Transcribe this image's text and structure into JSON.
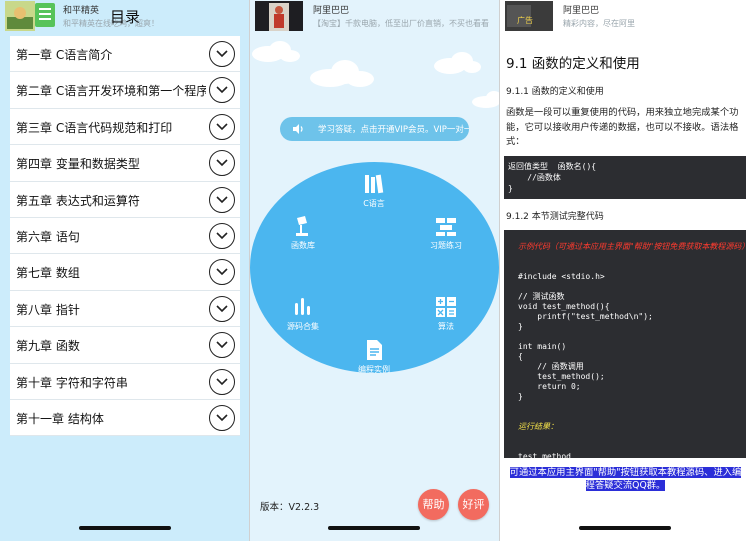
{
  "screen1": {
    "ad_title": "和平精英",
    "ad_subtitle": "和平精英在线吃鸡，超爽！",
    "title": "目录",
    "chapters": [
      "第一章 C语言简介",
      "第二章 C语言开发环境和第一个程序",
      "第三章 C语言代码规范和打印",
      "第四章 变量和数据类型",
      "第五章 表达式和运算符",
      "第六章 语句",
      "第七章 数组",
      "第八章 指针",
      "第九章 函数",
      "第十章 字符和字符串",
      "第十一章 结构体"
    ]
  },
  "screen2": {
    "ad_title": "阿里巴巴",
    "ad_subtitle": "【淘宝】千款电脑，低至出厂价直销，不买也看看",
    "notice": "学习答疑，点击开通VIP会员。VIP一对一答疑",
    "menu": {
      "c_lang": "C语言",
      "func_lib": "函数库",
      "exercises": "习题练习",
      "source_code": "源码合集",
      "algorithm": "算法",
      "examples": "编程实例"
    },
    "version": "版本：V2.2.3",
    "help_btn": "帮助",
    "rate_btn": "好评",
    "colors": {
      "circle": "#4bb6ef",
      "button": "#f26b5f"
    }
  },
  "screen3": {
    "ad_title": "阿里巴巴",
    "ad_subtitle": "精彩内容，尽在阿里",
    "heading": "9.1 函数的定义和使用",
    "sub1": "9.1.1 函数的定义和使用",
    "para": "函数是一段可以重复使用的代码，用来独立地完成某个功能，它可以接收用户传递的数据，也可以不接收。语法格式：",
    "code1": "返回值类型  函数名(){\n    //函数体\n}",
    "sub2": "9.1.2 本节测试完整代码",
    "note": "示例代码（可通过本应用主界面\"帮助\"按钮免费获取本教程源码）",
    "code2": "#include <stdio.h>\n\n// 测试函数\nvoid test_method(){\n    printf(\"test_method\\n\");\n}\n\nint main()\n{\n    // 函数调用\n    test_method();\n    return 0;\n}",
    "run_label": "运行结果：",
    "output": "test_method",
    "footer": "可通过本应用主界面\"帮助\"按钮获取本教程源码、进入编程答疑交流QQ群。"
  }
}
